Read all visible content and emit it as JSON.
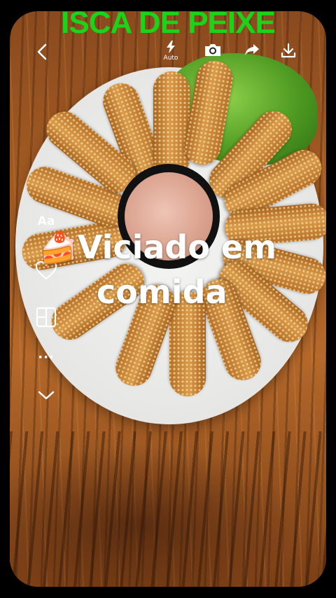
{
  "overlay_title": "ISCA DE PEIXE",
  "topbar": {
    "back_icon": "chevron-left-icon",
    "flash_icon": "lightning-icon",
    "flash_label": "Auto",
    "camera_icon": "camera-icon",
    "share_icon": "share-arrow-icon",
    "download_icon": "download-icon"
  },
  "tools": {
    "text_label": "Aa",
    "heart_icon": "heart-icon",
    "layout_icon": "layout-grid-icon",
    "more_label": "···",
    "collapse_icon": "chevron-down-icon"
  },
  "caption": {
    "emoji": "🍰",
    "line1": "Viciado em",
    "line2": "comida"
  },
  "colors": {
    "title": "#19d419",
    "background": "#000000"
  }
}
